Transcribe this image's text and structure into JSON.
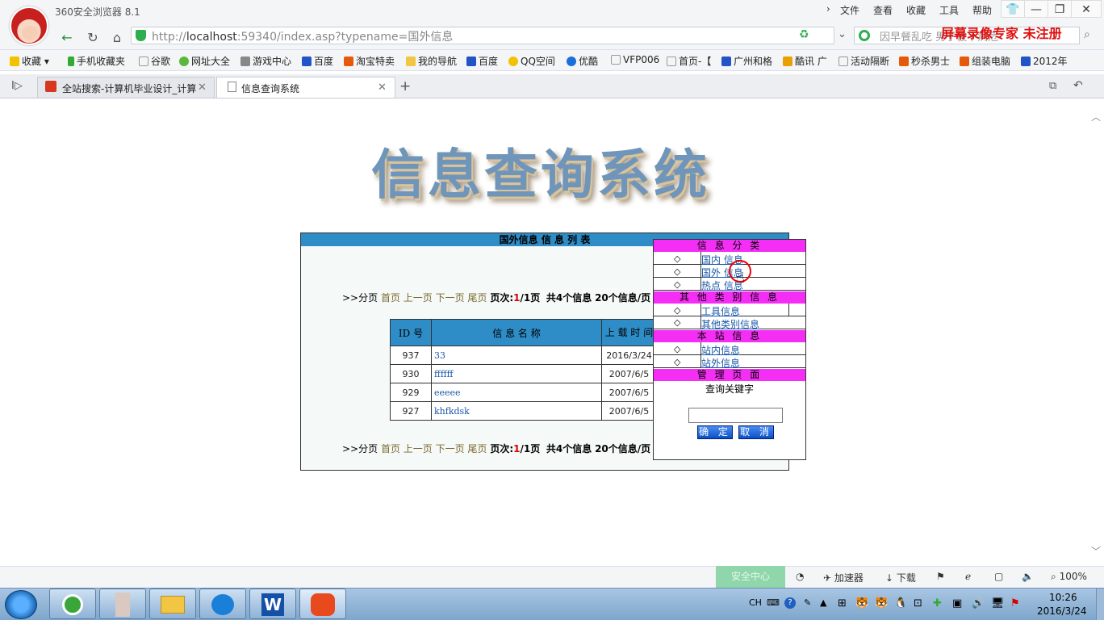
{
  "browser": {
    "app_title": "360安全浏览器 8.1",
    "menu": [
      "文件",
      "查看",
      "收藏",
      "工具",
      "帮助"
    ],
    "window_controls": [
      "👕",
      "—",
      "❐",
      "✕"
    ],
    "url_host": "http://",
    "url_main": "localhost",
    "url_rest": ":59340/index.asp?typename=国外信息",
    "search_placeholder": "因早餐乱吃 男子被下病危",
    "watermark": "屏幕录像专家  未注册",
    "bookmarks": [
      "收藏",
      "手机收藏夹",
      "谷歌",
      "网址大全",
      "游戏中心",
      "百度",
      "淘宝特卖",
      "我的导航",
      "百度",
      "QQ空间",
      "优酷",
      "VFP006",
      "首页-【",
      "广州和格",
      "酷讯 广",
      "活动隔断",
      "秒杀男士",
      "组装电脑",
      "2012年"
    ],
    "tabs": [
      {
        "label": "全站搜索-计算机毕业设计_计算"
      },
      {
        "label": "信息查询系统"
      }
    ],
    "new_tab": "+",
    "status": {
      "green_label": "安全中心",
      "accelerator": "加速器",
      "download": "下载",
      "zoom": "100%"
    }
  },
  "page": {
    "logo": "信息查询系统",
    "list_header": "国外信息 信 息 列 表",
    "pager": {
      "prefix": ">>分页",
      "first": "首页",
      "prev": "上一页",
      "next": "下一页",
      "last": "尾页",
      "page_label": "页次:",
      "page_current": "1",
      "page_total": "/1页",
      "count_text": "共4个信息",
      "per_page": "20个信息/页"
    },
    "table": {
      "headers": [
        "ID 号",
        "信 息 名 称",
        "上 载 时 间"
      ],
      "rows": [
        {
          "id": "937",
          "name": "33",
          "date": "2016/3/24"
        },
        {
          "id": "930",
          "name": "ffffff",
          "date": "2007/6/5"
        },
        {
          "id": "929",
          "name": "eeeee",
          "date": "2007/6/5"
        },
        {
          "id": "927",
          "name": "khfkdsk",
          "date": "2007/6/5"
        }
      ]
    },
    "sidebar": {
      "category_head": "信 息 分 类",
      "categories": [
        "国内 信息",
        "国外 信息",
        "热点 信息"
      ],
      "other_head": "其 他 类 别 信 息",
      "others": [
        "工具信息",
        "其他类别信息"
      ],
      "site_head": "本 站 信 息",
      "site_items": [
        "站内信息",
        "站外信息"
      ],
      "admin_head": "管 理 页 面",
      "query_label": "查询关键字",
      "ok_button": "确 定",
      "cancel_button": "取 消"
    }
  },
  "taskbar": {
    "tray_lang": "CH",
    "time": "10:26",
    "date": "2016/3/24"
  },
  "colors": {
    "list_header_bg": "#2e8cc6",
    "sidebar_head_bg": "#f52ef5",
    "button_blue": "#0b4fc8"
  }
}
